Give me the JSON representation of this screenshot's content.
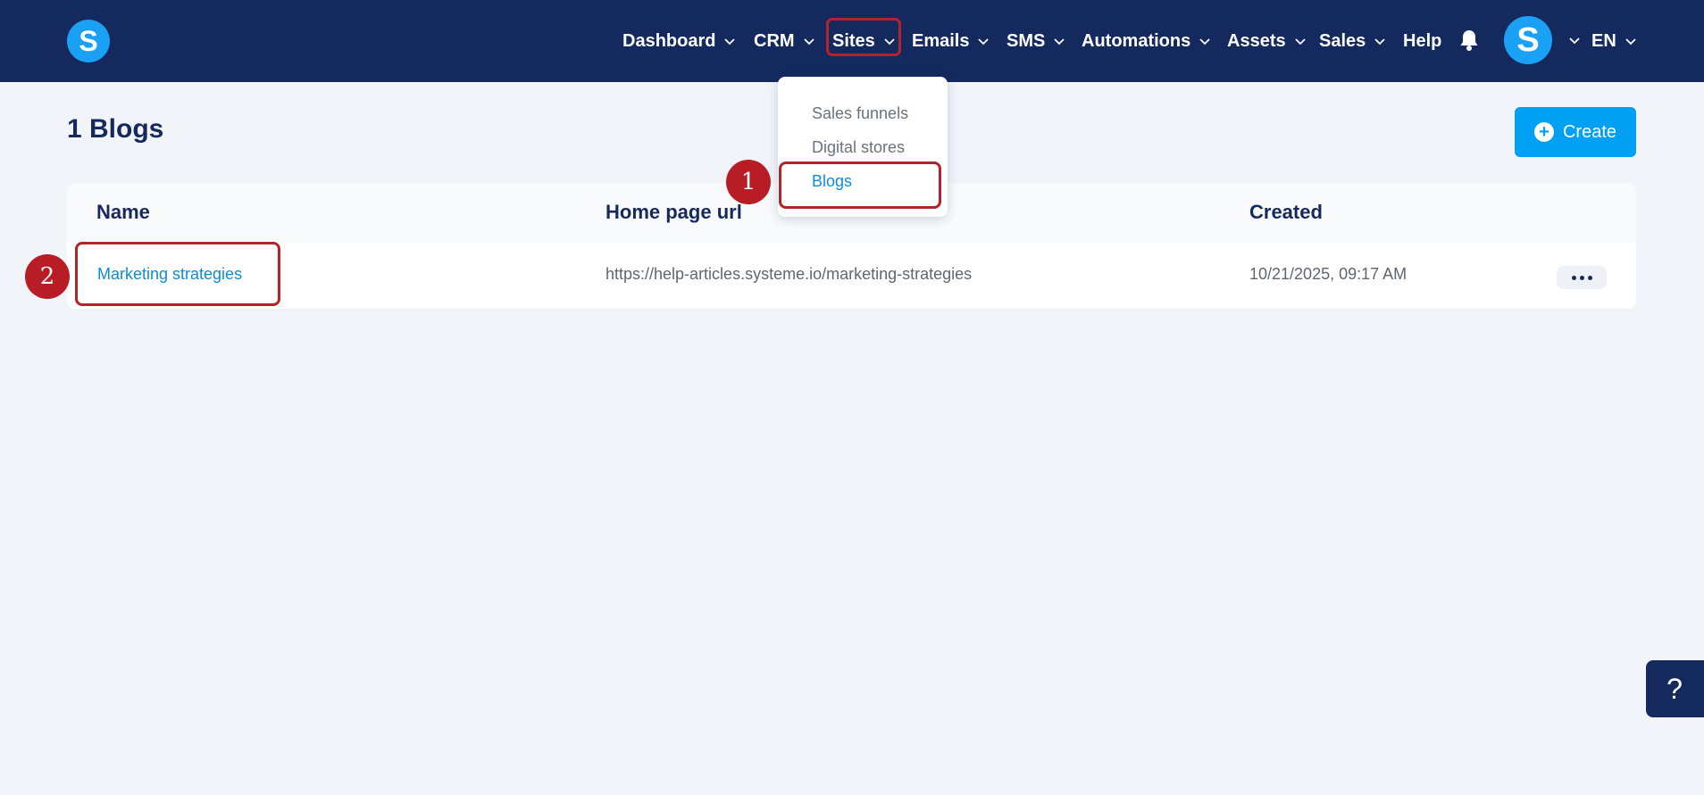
{
  "brand": {
    "logo_letter": "S"
  },
  "nav": {
    "items": [
      {
        "label": "Dashboard"
      },
      {
        "label": "CRM"
      },
      {
        "label": "Sites"
      },
      {
        "label": "Emails"
      },
      {
        "label": "SMS"
      },
      {
        "label": "Automations"
      },
      {
        "label": "Assets"
      },
      {
        "label": "Sales"
      },
      {
        "label": "Help"
      }
    ],
    "avatar_letter": "S",
    "language": "EN"
  },
  "sites_menu": {
    "items": [
      {
        "label": "Sales funnels"
      },
      {
        "label": "Digital stores"
      },
      {
        "label": "Blogs"
      }
    ],
    "active_index": 2
  },
  "page": {
    "title": "1 Blogs",
    "create_label": "Create"
  },
  "table": {
    "columns": [
      "Name",
      "Home page url",
      "Created"
    ],
    "rows": [
      {
        "name": "Marketing strategies",
        "url": "https://help-articles.systeme.io/marketing-strategies",
        "created": "10/21/2025, 09:17 AM"
      }
    ]
  },
  "annotations": {
    "step1": "1",
    "step2": "2"
  },
  "help_fab": {
    "label": "?"
  },
  "colors": {
    "topbar": "#142a5e",
    "accent": "#00a0f2",
    "link": "#0d8bd6",
    "highlight": "#b3232b",
    "background": "#f1f4f9"
  }
}
